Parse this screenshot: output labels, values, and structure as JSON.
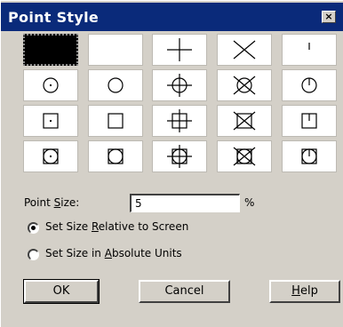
{
  "window": {
    "title": "Point Style",
    "close_glyph": "×",
    "titlebar_color": "#0a2a7a",
    "face_color": "#d4d0c8"
  },
  "styles": [
    {
      "name": "point-dot",
      "selected": true
    },
    {
      "name": "point-none",
      "selected": false
    },
    {
      "name": "point-plus",
      "selected": false
    },
    {
      "name": "point-x",
      "selected": false
    },
    {
      "name": "point-tick",
      "selected": false
    },
    {
      "name": "point-circle-dot",
      "selected": false
    },
    {
      "name": "point-circle-none",
      "selected": false
    },
    {
      "name": "point-circle-plus",
      "selected": false
    },
    {
      "name": "point-circle-x",
      "selected": false
    },
    {
      "name": "point-circle-tick",
      "selected": false
    },
    {
      "name": "point-square-dot",
      "selected": false
    },
    {
      "name": "point-square-none",
      "selected": false
    },
    {
      "name": "point-square-plus",
      "selected": false
    },
    {
      "name": "point-square-x",
      "selected": false
    },
    {
      "name": "point-square-tick",
      "selected": false
    },
    {
      "name": "point-circle-square-dot",
      "selected": false
    },
    {
      "name": "point-circle-square-none",
      "selected": false
    },
    {
      "name": "point-circle-square-plus",
      "selected": false
    },
    {
      "name": "point-circle-square-x",
      "selected": false
    },
    {
      "name": "point-circle-square-tick",
      "selected": false
    }
  ],
  "point_size": {
    "label_pre": "Point ",
    "label_key": "S",
    "label_post": "ize:",
    "value": "5",
    "unit": "%"
  },
  "options": {
    "relative": {
      "pre": "Set Size ",
      "key": "R",
      "post": "elative to Screen",
      "checked": true
    },
    "absolute": {
      "pre": "Set Size in ",
      "key": "A",
      "post": "bsolute Units",
      "checked": false
    }
  },
  "buttons": {
    "ok": "OK",
    "cancel": "Cancel",
    "help_key": "H",
    "help_rest": "elp"
  }
}
